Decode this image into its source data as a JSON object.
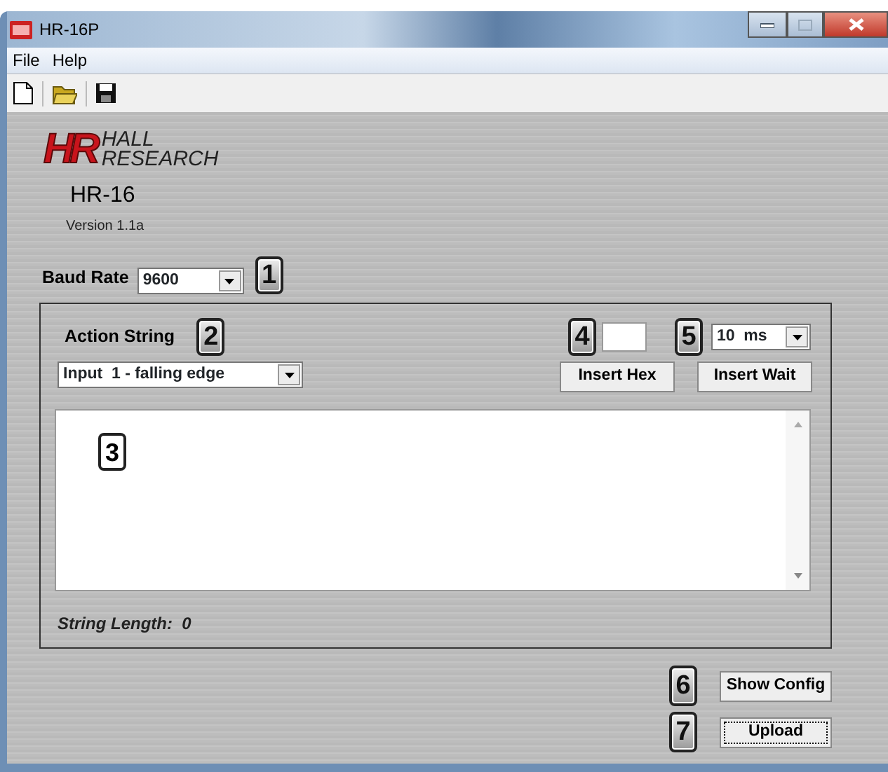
{
  "window": {
    "title": "HR-16P"
  },
  "menu": [
    {
      "label": "File"
    },
    {
      "label": "Help"
    }
  ],
  "toolbar": [
    {
      "kind": "new"
    },
    {
      "kind": "open"
    },
    {
      "kind": "save"
    }
  ],
  "logo": {
    "mark": "HR",
    "lines": [
      "HALL",
      "RESEARCH"
    ]
  },
  "product": "HR-16",
  "version": "Version 1.1a",
  "baud": {
    "label": "Baud Rate",
    "value": "9600",
    "callout": "1"
  },
  "action": {
    "label": "Action String",
    "callout": "2",
    "event": "Input  1 - falling edge",
    "hex": {
      "callout": "4"
    },
    "wait": {
      "callout": "5",
      "value": "10  ms"
    },
    "buttons": [
      "Insert Hex",
      "Insert Wait"
    ],
    "editor": {
      "callout": "3"
    },
    "length": {
      "label": "String Length:",
      "value": "0"
    }
  },
  "actions": [
    {
      "label": "Show Config",
      "callout": "6",
      "focused": false
    },
    {
      "label": "Upload",
      "callout": "7",
      "focused": true
    }
  ]
}
